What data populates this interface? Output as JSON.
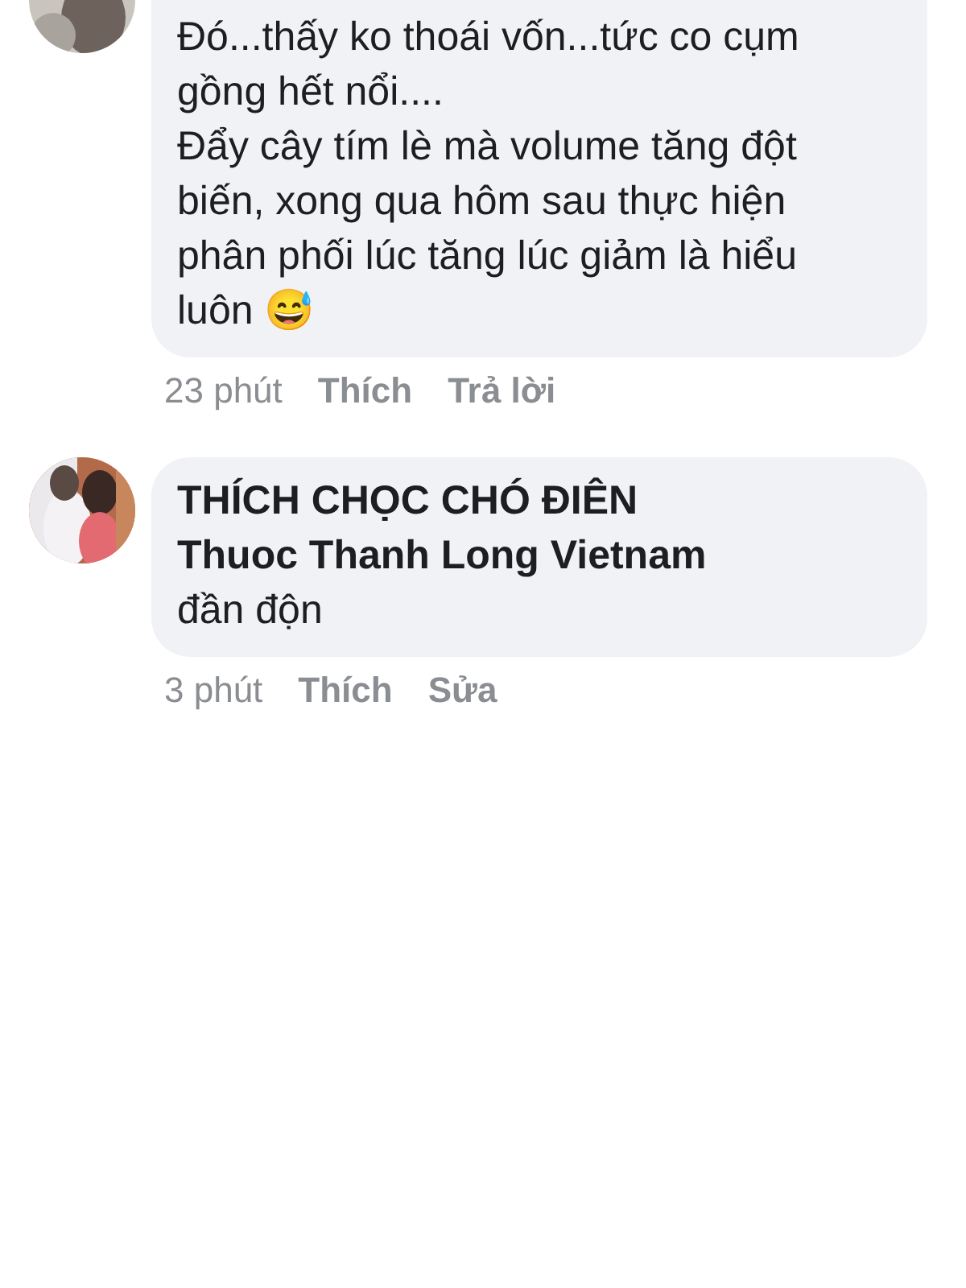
{
  "comments": [
    {
      "kind": "reply",
      "top_cut": true,
      "paragraphs": [
        "Đó...thấy ko thoái vốn...tức co cụm gồng hết nổi....",
        "Đẩy cây tím lè mà volume tăng đột biến, xong qua hôm sau thực hiện phân phối lúc tăng lúc giảm là hiểu luôn 😅"
      ],
      "time": "23 phút",
      "actions": [
        "Thích",
        "Trả lời"
      ]
    },
    {
      "kind": "own",
      "top_cut": false,
      "author": "THÍCH CHỌC CHÓ ĐIÊN",
      "mention": "Thuoc Thanh Long Vietnam",
      "paragraphs": [
        "đần độn"
      ],
      "time": "3 phút",
      "actions": [
        "Thích",
        "Sửa"
      ]
    }
  ]
}
